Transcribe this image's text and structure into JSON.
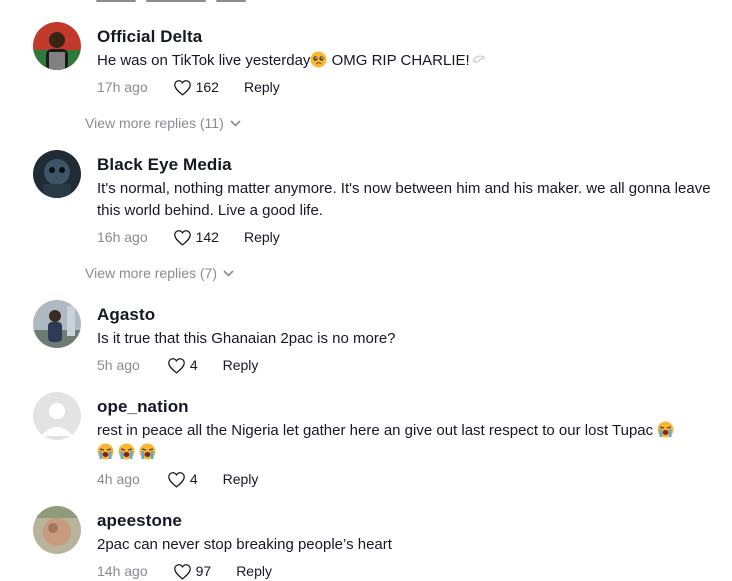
{
  "comments": [
    {
      "username": "Official Delta",
      "text": "He was on TikTok live yesterday",
      "text_tail": " OMG RIP CHARLIE!",
      "time": "17h ago",
      "likes": "162",
      "reply": "Reply",
      "view_more": "View more replies (11)"
    },
    {
      "username": "Black Eye Media",
      "text": "It's normal, nothing matter anymore. It's now between him and his maker. we all gonna leave this world behind. Live a good life.",
      "time": "16h ago",
      "likes": "142",
      "reply": "Reply",
      "view_more": "View more replies (7)"
    },
    {
      "username": "Agasto",
      "text": "Is it true that this Ghanaian 2pac is no more?",
      "time": "5h ago",
      "likes": "4",
      "reply": "Reply"
    },
    {
      "username": "ope_nation",
      "text": "rest in peace all the Nigeria let gather here an give out last respect to our lost Tupac",
      "time": "4h ago",
      "likes": "4",
      "reply": "Reply"
    },
    {
      "username": "apeestone",
      "text": "2pac can never stop breaking people’s heart",
      "time": "14h ago",
      "likes": "97",
      "reply": "Reply"
    }
  ],
  "icons": {
    "like": "heart-outline-icon",
    "expand": "chevron-down-icon",
    "emoji_pleading": "pleading-face-emoji",
    "emoji_crying": "loudly-crying-face-emoji",
    "emoji_dove": "dove-emoji"
  },
  "colors": {
    "text_primary": "#161823",
    "text_secondary": "#8a8b91",
    "emoji_yellow": "#f7b733"
  }
}
